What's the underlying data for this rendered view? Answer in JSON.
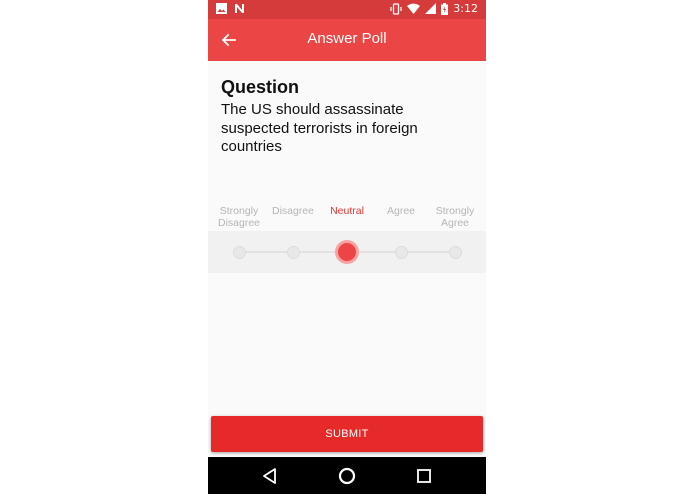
{
  "status_bar": {
    "time": "3:12",
    "left_icons": [
      "image-icon",
      "n-icon"
    ],
    "right_icons": [
      "vibrate-icon",
      "wifi-icon",
      "signal-icon",
      "battery-icon"
    ]
  },
  "app_bar": {
    "title": "Answer Poll",
    "back_icon": "arrow-left-icon",
    "color": "#ec4545"
  },
  "question": {
    "heading": "Question",
    "text": "The US should assassinate suspected terrorists in foreign countries"
  },
  "scale": {
    "options": [
      "Strongly Disagree",
      "Disagree",
      "Neutral",
      "Agree",
      "Strongly Agree"
    ],
    "selected_index": 2,
    "selected_value": "Neutral",
    "accent_color": "#e53935"
  },
  "submit": {
    "label": "SUBMIT",
    "color": "#e62a2a"
  },
  "nav_bar": {
    "icons": [
      "back-triangle-icon",
      "home-circle-icon",
      "recents-square-icon"
    ]
  }
}
